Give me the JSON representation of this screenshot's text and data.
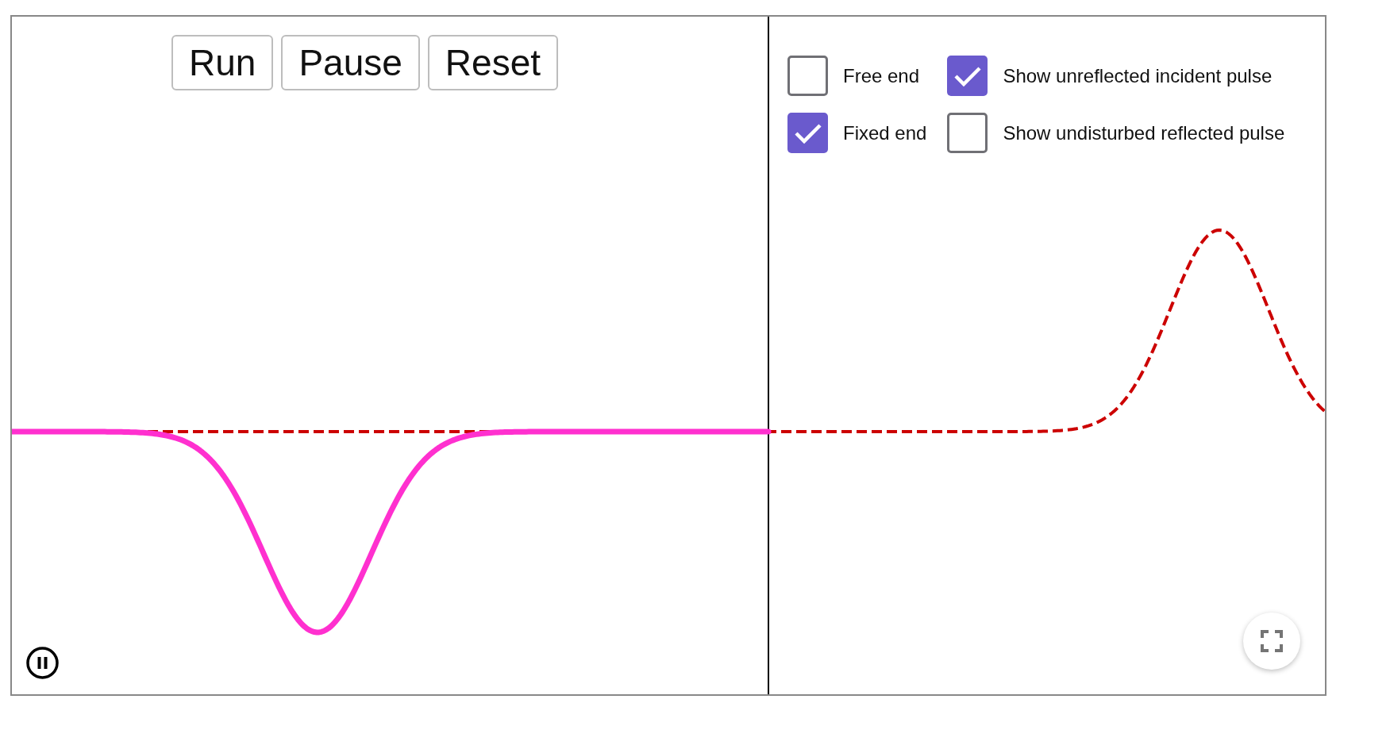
{
  "buttons": [
    {
      "label": "Run"
    },
    {
      "label": "Pause"
    },
    {
      "label": "Reset"
    }
  ],
  "options": [
    {
      "label": "Free end",
      "checked": false
    },
    {
      "label": "Show unreflected incident pulse",
      "checked": true
    },
    {
      "label": "Fixed end",
      "checked": true
    },
    {
      "label": "Show undisturbed reflected pulse",
      "checked": false
    }
  ]
}
